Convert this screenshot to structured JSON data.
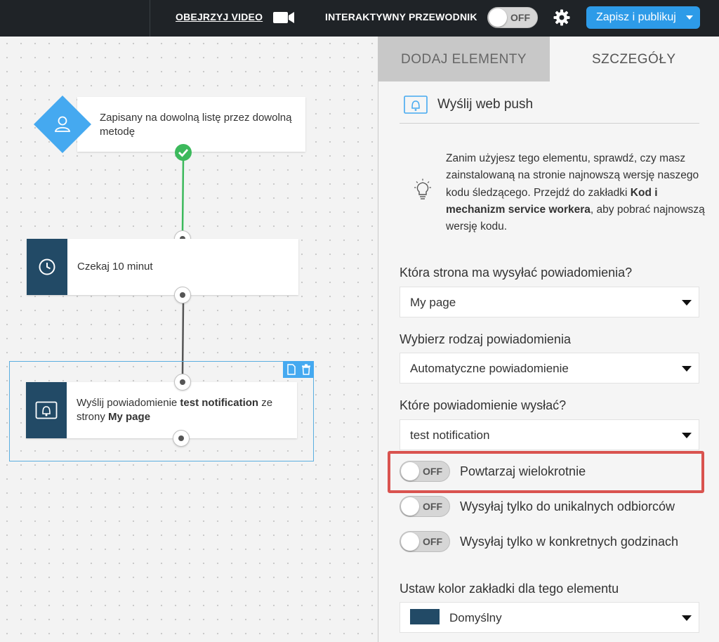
{
  "header": {
    "video_label": "OBEJRZYJ VIDEO",
    "guide_label": "INTERAKTYWNY PRZEWODNIK",
    "guide_toggle": "OFF",
    "publish_label": "Zapisz i publikuj"
  },
  "canvas": {
    "trigger_text": "Zapisany na dowolną listę przez dowolną metodę",
    "wait_text": "Czekaj 10 minut",
    "send_prefix": "Wyślij powiadomienie ",
    "send_name": "test notification",
    "send_middle": " ze strony ",
    "send_page": "My page"
  },
  "panel": {
    "tabs": [
      {
        "label": "DODAJ ELEMENTY"
      },
      {
        "label": "SZCZEGÓŁY"
      }
    ],
    "element_title": "Wyślij web push",
    "info": {
      "part1": "Zanim użyjesz tego elementu, sprawdź, czy masz zainstalowaną na stronie najnowszą wersję naszego kodu śledzącego. Przejdź do zakładki ",
      "bold": "Kod i mechanizm service workera",
      "part2": ", aby pobrać najnowszą wersję kodu."
    },
    "site_label": "Która strona ma wysyłać powiadomienia?",
    "site_value": "My page",
    "type_label": "Wybierz rodzaj powiadomienia",
    "type_value": "Automatyczne powiadomienie",
    "notif_label": "Które powiadomienie wysłać?",
    "notif_value": "test notification",
    "options": [
      {
        "label": "Powtarzaj wielokrotnie",
        "toggle": "OFF"
      },
      {
        "label": "Wysyłaj tylko do unikalnych odbiorców",
        "toggle": "OFF"
      },
      {
        "label": "Wysyłaj tylko w konkretnych godzinach",
        "toggle": "OFF"
      }
    ],
    "color_label": "Ustaw kolor zakładki dla tego elementu",
    "color_value": "Domyślny"
  },
  "colors": {
    "topbar": "#1f2327",
    "accent": "#2d9be8",
    "node_dark": "#224a66",
    "trigger": "#45a9f0",
    "highlight": "#d9534f",
    "success": "#3cb95c"
  }
}
